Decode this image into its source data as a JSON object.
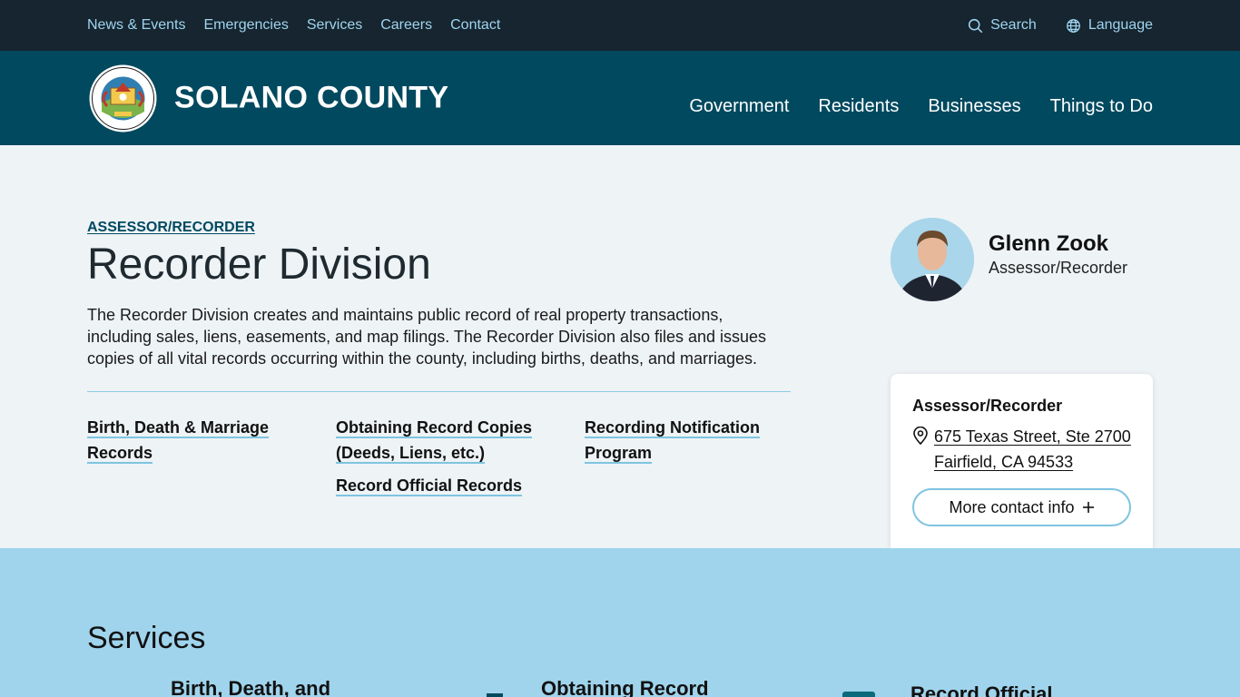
{
  "utility_nav": {
    "links": [
      "News & Events",
      "Emergencies",
      "Services",
      "Careers",
      "Contact"
    ],
    "search_label": "Search",
    "language_label": "Language"
  },
  "header": {
    "site_title": "SOLANO COUNTY",
    "nav": [
      "Government",
      "Residents",
      "Businesses",
      "Things to Do"
    ]
  },
  "main": {
    "eyebrow": "ASSESSOR/RECORDER",
    "title": "Recorder Division",
    "intro": "The Recorder Division creates and maintains public record of real property transactions, including sales, liens, easements, and map filings. The Recorder Division also files and issues copies of all vital records occurring within the county, including births, deaths, and marriages.",
    "quick_links": [
      "Birth, Death & Marriage Records",
      "Obtaining Record Copies (Deeds, Liens, etc.)",
      "Record Official Records",
      "Recording Notification Program"
    ]
  },
  "profile": {
    "name": "Glenn Zook",
    "role": "Assessor/Recorder"
  },
  "contact_card": {
    "title": "Assessor/Recorder",
    "address_line1": "675 Texas Street, Ste 2700",
    "address_line2": "Fairfield, CA 94533",
    "more_label": "More contact info"
  },
  "services": {
    "title": "Services",
    "items": [
      "Birth, Death, and",
      "Obtaining Record",
      "Record Official"
    ]
  },
  "colors": {
    "utility_bg": "#16252f",
    "header_bg": "#00495f",
    "accent_light": "#9fd4ec",
    "link_underline": "#7fc4e0"
  }
}
